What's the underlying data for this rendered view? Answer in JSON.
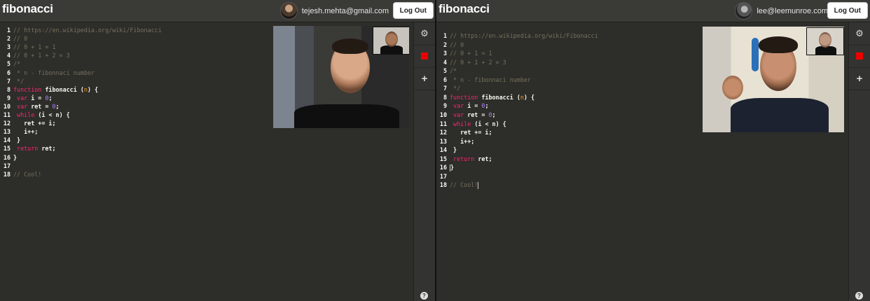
{
  "panes": [
    {
      "brand": "fibonacci",
      "user_email": "tejesh.mehta@gmail.com",
      "logout_label": "Log Out",
      "cursor_line": 0
    },
    {
      "brand": "fibonacci",
      "user_email": "lee@leemunroe.com",
      "logout_label": "Log Out",
      "cursor_line": 16
    }
  ],
  "code_lines": [
    [
      [
        "c",
        "// https://en.wikipedia.org/wiki/Fibonacci"
      ]
    ],
    [
      [
        "c",
        "// 0"
      ]
    ],
    [
      [
        "c",
        "// 0 + 1 = 1"
      ]
    ],
    [
      [
        "c",
        "// 0 + 1 + 2 = 3"
      ]
    ],
    [
      [
        "c",
        "/*"
      ]
    ],
    [
      [
        "c",
        " * n - fibonnaci number"
      ]
    ],
    [
      [
        "c",
        " */"
      ]
    ],
    [
      [
        "k",
        "function "
      ],
      [
        "f",
        "fibonacci "
      ],
      [
        "t",
        "("
      ],
      [
        "p",
        "n"
      ],
      [
        "t",
        ") {"
      ]
    ],
    [
      [
        "t",
        " "
      ],
      [
        "k",
        "var "
      ],
      [
        "t",
        "i = "
      ],
      [
        "n",
        "0"
      ],
      [
        "t",
        ";"
      ]
    ],
    [
      [
        "t",
        " "
      ],
      [
        "k",
        "var "
      ],
      [
        "t",
        "ret = "
      ],
      [
        "n",
        "0"
      ],
      [
        "t",
        ";"
      ]
    ],
    [
      [
        "t",
        " "
      ],
      [
        "k",
        "while "
      ],
      [
        "t",
        "(i < n) {"
      ]
    ],
    [
      [
        "t",
        "   ret += i;"
      ]
    ],
    [
      [
        "t",
        "   i++;"
      ]
    ],
    [
      [
        "t",
        " }"
      ]
    ],
    [
      [
        "t",
        " "
      ],
      [
        "k",
        "return "
      ],
      [
        "t",
        "ret;"
      ]
    ],
    [
      [
        "t",
        "}"
      ]
    ],
    [
      [
        "t",
        ""
      ]
    ],
    [
      [
        "c",
        "// Cool!"
      ]
    ]
  ],
  "icons": {
    "settings": "gear-icon",
    "record": "stop-icon",
    "add": "plus-icon",
    "help": "question-icon"
  },
  "colors": {
    "editor_bg": "#2d2d29",
    "comment": "#75715e",
    "keyword": "#f92672",
    "param": "#fd971f",
    "number": "#ae81ff",
    "record": "#e00000"
  },
  "sidebar": {
    "settings_glyph": "⚙",
    "add_glyph": "+",
    "help_glyph": "?"
  }
}
